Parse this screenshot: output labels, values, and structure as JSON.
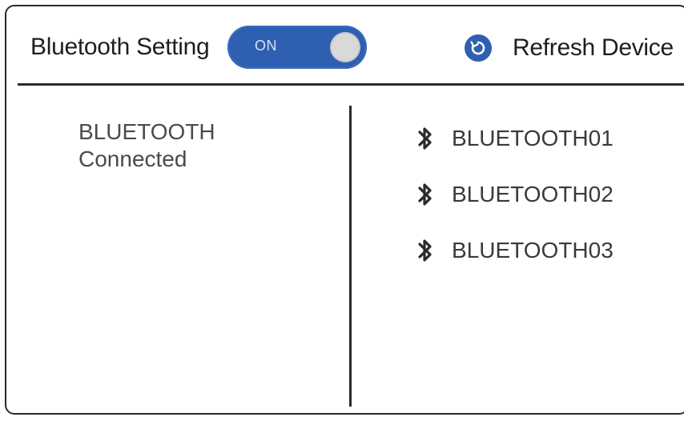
{
  "header": {
    "title": "Bluetooth Setting",
    "toggle": {
      "label": "ON",
      "state": "on"
    },
    "refresh_label": "Refresh Device"
  },
  "status": {
    "line1": "BLUETOOTH",
    "line2": "Connected"
  },
  "devices": [
    {
      "label": "BLUETOOTH01"
    },
    {
      "label": "BLUETOOTH02"
    },
    {
      "label": "BLUETOOTH03"
    }
  ],
  "colors": {
    "accent": "#2f5fb0",
    "border": "#2a2a2a",
    "text": "#1e1e1e",
    "muted_text": "#4a4a4a"
  },
  "icons": {
    "refresh": "refresh-icon",
    "device": "bluetooth-icon"
  }
}
